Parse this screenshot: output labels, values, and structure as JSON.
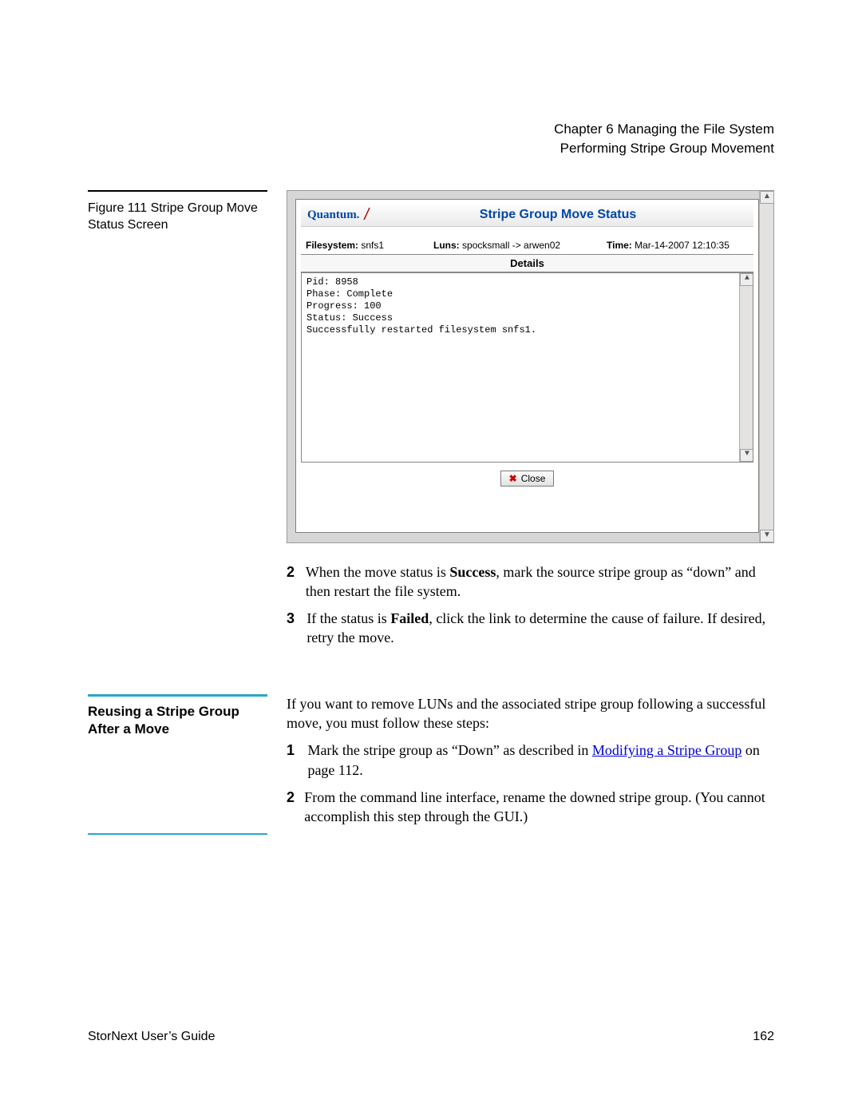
{
  "header": {
    "chapter": "Chapter 6  Managing the File System",
    "section": "Performing Stripe Group Movement"
  },
  "figure": {
    "label": "Figure 111  Stripe Group Move Status Screen"
  },
  "shot": {
    "brand": "Quantum.",
    "title": "Stripe Group Move Status",
    "fs_label": "Filesystem:",
    "fs_value": "snfs1",
    "luns_label": "Luns:",
    "luns_value": "spocksmall -> arwen02",
    "time_label": "Time:",
    "time_value": "Mar-14-2007 12:10:35",
    "details_header": "Details",
    "details_body": "Pid: 8958\nPhase: Complete\nProgress: 100\nStatus: Success\nSuccessfully restarted filesystem snfs1.",
    "close_label": "Close"
  },
  "steps_a": [
    {
      "n": "2",
      "pre": "When the move status is ",
      "bold": "Success",
      "post": ", mark the source stripe group as “down” and then restart the file system."
    },
    {
      "n": "3",
      "pre": "If the status is ",
      "bold": "Failed",
      "post": ", click the link to determine the cause of failure. If desired, retry the move."
    }
  ],
  "section2": {
    "title": "Reusing a Stripe Group After a Move",
    "intro": "If you want to remove LUNs and the associated stripe group following a successful move, you must follow these steps:",
    "step1_n": "1",
    "step1_a": "Mark the stripe group as “Down” as described in ",
    "step1_link": "Modifying a Stripe Group",
    "step1_b": " on page  112.",
    "step2_n": "2",
    "step2": "From the command line interface, rename the downed stripe group. (You cannot accomplish this step through the GUI.)"
  },
  "footer": {
    "left": "StorNext User’s Guide",
    "right": "162"
  }
}
